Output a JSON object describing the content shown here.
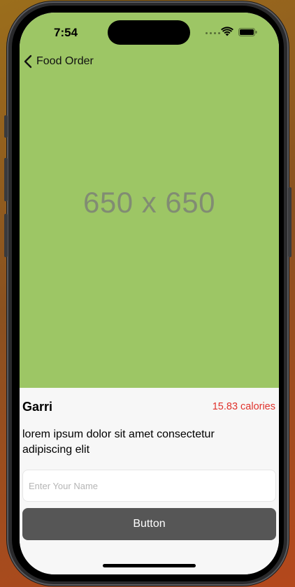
{
  "status_bar": {
    "time": "7:54"
  },
  "nav": {
    "back_label": "Food Order",
    "back_icon": "chevron-left-icon"
  },
  "hero": {
    "placeholder_text": "650 x 650",
    "background_color": "#9dc665"
  },
  "item": {
    "name": "Garri",
    "calories": "15.83 calories",
    "description": "lorem ipsum dolor sit amet consectetur adipiscing elit"
  },
  "form": {
    "name_placeholder": "Enter Your Name",
    "name_value": "",
    "button_label": "Button"
  },
  "colors": {
    "calories_accent": "#e0322c",
    "button_background": "#565656"
  }
}
